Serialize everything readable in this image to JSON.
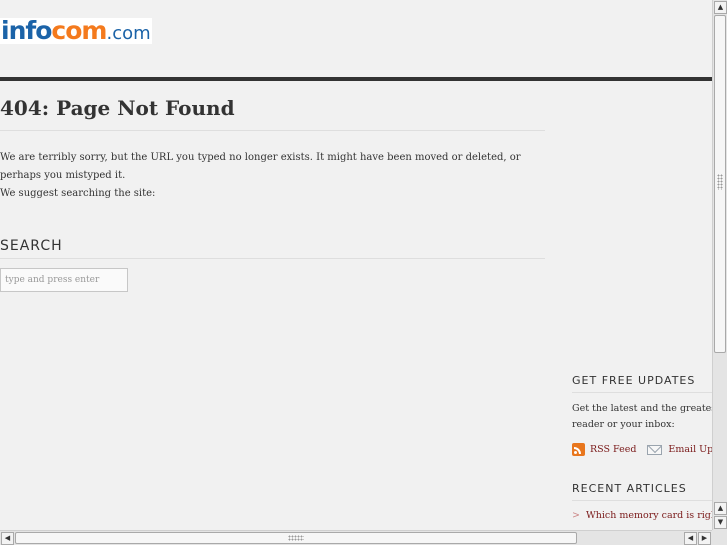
{
  "logo": {
    "part1": "info",
    "part2": "com",
    "part3": ".com"
  },
  "main": {
    "title": "404: Page Not Found",
    "message1": "We are terribly sorry, but the URL you typed no longer exists. It might have been moved or deleted, or perhaps you mistyped it.",
    "message2": "We suggest searching the site:",
    "search_heading": "SEARCH",
    "search_placeholder": "type and press enter"
  },
  "sidebar": {
    "updates_heading": "GET FREE UPDATES",
    "updates_text_line1": "Get the latest and the greatest new",
    "updates_text_line2": "reader or your inbox:",
    "rss_label": "RSS Feed",
    "email_label": "Email Upda",
    "recent_heading": "RECENT ARTICLES",
    "articles": [
      {
        "title": "Which memory card is right f"
      }
    ]
  },
  "scrollbar": {
    "up": "▲",
    "down": "▼",
    "left": "◀",
    "right": "▶"
  },
  "colors": {
    "logo_blue": "#1b63a8",
    "logo_orange": "#f47a1d",
    "link": "#7a1a1a",
    "bar": "#333333"
  }
}
